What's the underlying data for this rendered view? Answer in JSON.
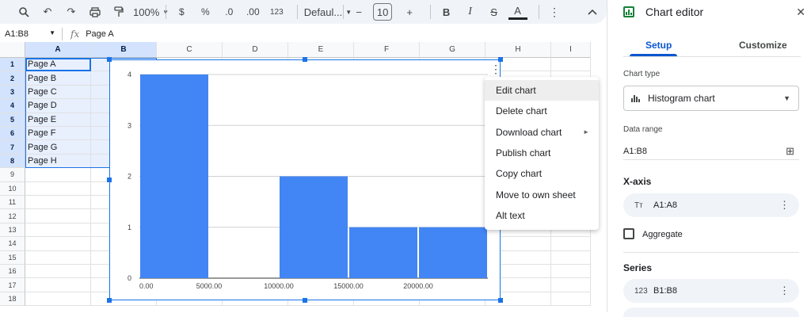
{
  "toolbar": {
    "zoom": "100%",
    "currency": "$",
    "percent": "%",
    "dec_decrease": ".0",
    "dec_increase": ".00",
    "number_format": "123",
    "font": "Defaul...",
    "font_size": "10",
    "minus": "−",
    "plus": "+",
    "bold": "B",
    "italic": "I",
    "strike": "S",
    "text_color": "A"
  },
  "formula_bar": {
    "name_box": "A1:B8",
    "fx": "fx",
    "value": "Page A"
  },
  "grid": {
    "columns": [
      "A",
      "B",
      "C",
      "D",
      "E",
      "F",
      "G",
      "H",
      "I"
    ],
    "rows": [
      "1",
      "2",
      "3",
      "4",
      "5",
      "6",
      "7",
      "8",
      "9",
      "10",
      "11",
      "12",
      "13",
      "14",
      "15",
      "16",
      "17",
      "18"
    ],
    "cells_a": [
      "Page A",
      "Page B",
      "Page C",
      "Page D",
      "Page E",
      "Page F",
      "Page G",
      "Page H"
    ]
  },
  "chart_data": {
    "type": "bar",
    "title": "",
    "xlabel": "",
    "ylabel": "",
    "bins": [
      [
        0,
        5000
      ],
      [
        5000,
        10000
      ],
      [
        10000,
        15000
      ],
      [
        15000,
        20000
      ],
      [
        20000,
        25000
      ]
    ],
    "values": [
      4,
      0,
      2,
      1,
      1
    ],
    "x_ticks": [
      "0.00",
      "5000.00",
      "10000.00",
      "15000.00",
      "20000.00"
    ],
    "y_ticks": [
      "0",
      "1",
      "2",
      "3",
      "4"
    ],
    "ylim": [
      0,
      4
    ],
    "grid": true,
    "color": "#4285f4"
  },
  "context_menu": {
    "items": [
      "Edit chart",
      "Delete chart",
      "Download chart",
      "Publish chart",
      "Copy chart",
      "Move to own sheet",
      "Alt text"
    ]
  },
  "editor": {
    "title": "Chart editor",
    "tab_setup": "Setup",
    "tab_customize": "Customize",
    "chart_type_label": "Chart type",
    "chart_type_value": "Histogram chart",
    "data_range_label": "Data range",
    "data_range_value": "A1:B8",
    "x_axis_label": "X-axis",
    "x_axis_value": "A1:A8",
    "x_axis_icon": "Tт",
    "aggregate_label": "Aggregate",
    "series_label": "Series",
    "series_value": "B1:B8",
    "series_icon": "123"
  },
  "colors": {
    "accent": "#1a73e8",
    "bar": "#4285f4",
    "sheets_green": "#188038"
  }
}
